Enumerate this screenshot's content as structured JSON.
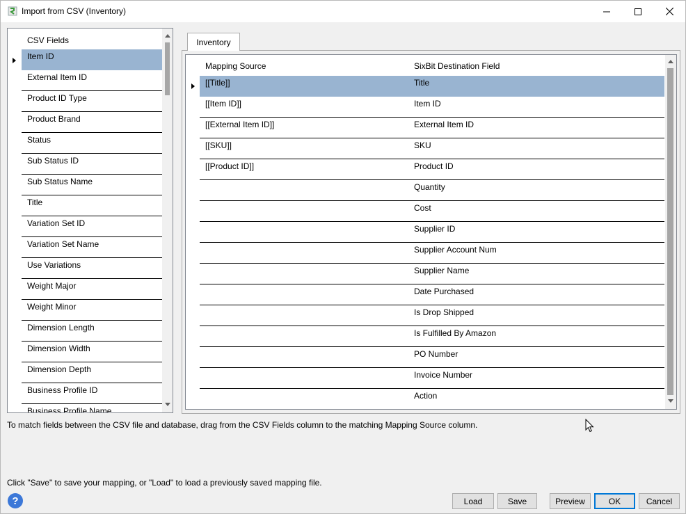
{
  "window": {
    "title": "Import from CSV (Inventory)",
    "icon": "sixbit-icon"
  },
  "csv_fields": {
    "header": "CSV Fields",
    "items": [
      "Item ID",
      "External Item ID",
      "Product ID Type",
      "Product Brand",
      "Status",
      "Sub Status ID",
      "Sub Status Name",
      "Title",
      "Variation Set ID",
      "Variation Set Name",
      "Use Variations",
      "Weight Major",
      "Weight Minor",
      "Dimension Length",
      "Dimension Width",
      "Dimension Depth",
      "Business Profile ID",
      "Business Profile Name"
    ],
    "selected": "Item ID"
  },
  "tabs": [
    {
      "label": "Inventory"
    }
  ],
  "mapping": {
    "columns": {
      "source": "Mapping Source",
      "destination": "SixBit Destination Field"
    },
    "rows": [
      {
        "source": "[[Title]]",
        "destination": "Title"
      },
      {
        "source": "[[Item ID]]",
        "destination": "Item ID"
      },
      {
        "source": "[[External Item ID]]",
        "destination": "External Item ID"
      },
      {
        "source": "[[SKU]]",
        "destination": "SKU"
      },
      {
        "source": "[[Product ID]]",
        "destination": "Product ID"
      },
      {
        "source": "",
        "destination": "Quantity"
      },
      {
        "source": "",
        "destination": "Cost"
      },
      {
        "source": "",
        "destination": "Supplier ID"
      },
      {
        "source": "",
        "destination": "Supplier Account Num"
      },
      {
        "source": "",
        "destination": "Supplier Name"
      },
      {
        "source": "",
        "destination": "Date Purchased"
      },
      {
        "source": "",
        "destination": "Is Drop Shipped"
      },
      {
        "source": "",
        "destination": "Is Fulfilled By Amazon"
      },
      {
        "source": "",
        "destination": "PO Number"
      },
      {
        "source": "",
        "destination": "Invoice Number"
      },
      {
        "source": "",
        "destination": "Action"
      }
    ],
    "selected": "[[Title]]"
  },
  "hints": {
    "drag": "To match fields between the CSV file and database, drag from the CSV Fields column to the matching Mapping Source column.",
    "save": "Click \"Save\" to save your mapping, or \"Load\" to load a previously saved mapping file."
  },
  "help": {
    "glyph": "?"
  },
  "buttons": {
    "load": "Load",
    "save": "Save",
    "preview": "Preview",
    "ok": "OK",
    "cancel": "Cancel"
  },
  "colors": {
    "selection": "#99b4d1",
    "default_button_border": "#0078d7"
  }
}
